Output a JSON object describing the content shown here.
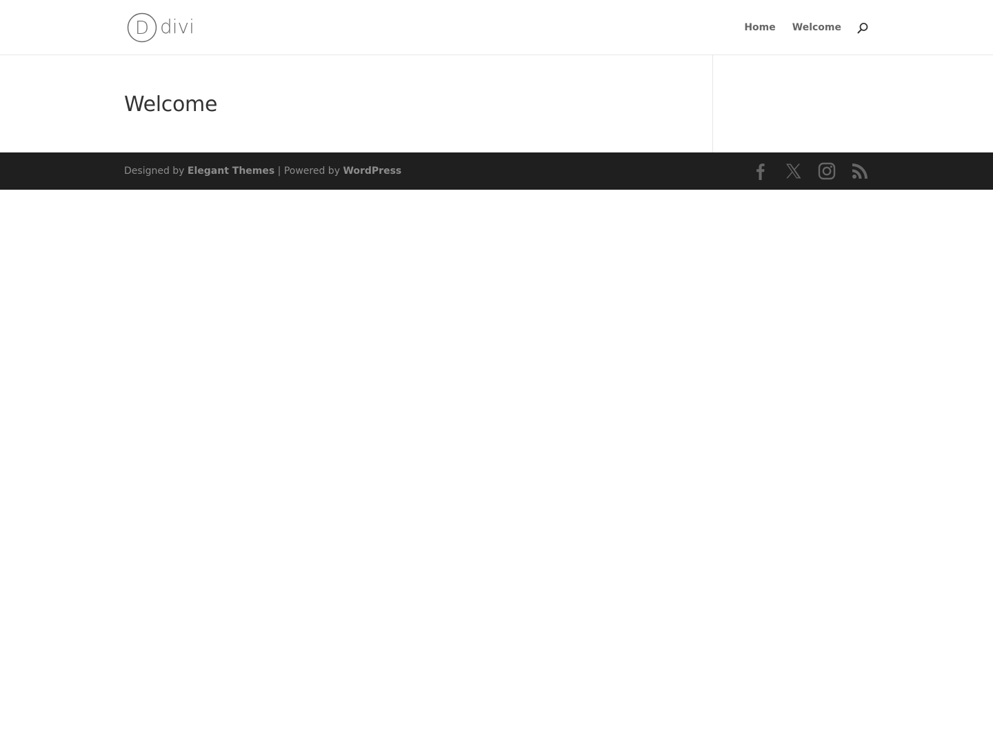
{
  "header": {
    "logo_text": "divi",
    "logo_letter": "D",
    "nav": [
      {
        "label": "Home"
      },
      {
        "label": "Welcome"
      }
    ],
    "search_icon": "search-icon"
  },
  "main": {
    "title": "Welcome"
  },
  "footer": {
    "credits_prefix": "Designed by ",
    "credits_link1": "Elegant Themes",
    "credits_mid": " | Powered by ",
    "credits_link2": "WordPress",
    "social": [
      {
        "icon": "facebook-icon"
      },
      {
        "icon": "x-icon"
      },
      {
        "icon": "instagram-icon"
      },
      {
        "icon": "rss-icon"
      }
    ]
  },
  "colors": {
    "footer_bg": "#1f1f1f",
    "footer_text": "#8c8c8c",
    "nav_text": "#666666",
    "title_text": "#333333",
    "icon": "#666666"
  }
}
